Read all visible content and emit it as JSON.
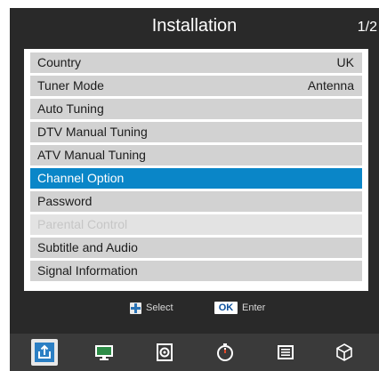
{
  "header": {
    "title": "Installation",
    "page_indicator": "1/2"
  },
  "menu": {
    "items": [
      {
        "label": "Country",
        "value": "UK",
        "state": "normal"
      },
      {
        "label": "Tuner Mode",
        "value": "Antenna",
        "state": "normal"
      },
      {
        "label": "Auto Tuning",
        "value": "",
        "state": "normal"
      },
      {
        "label": "DTV Manual Tuning",
        "value": "",
        "state": "normal"
      },
      {
        "label": "ATV Manual Tuning",
        "value": "",
        "state": "normal"
      },
      {
        "label": "Channel Option",
        "value": "",
        "state": "selected"
      },
      {
        "label": "Password",
        "value": "",
        "state": "normal"
      },
      {
        "label": "Parental Control",
        "value": "",
        "state": "disabled"
      },
      {
        "label": "Subtitle and Audio",
        "value": "",
        "state": "normal"
      },
      {
        "label": "Signal Information",
        "value": "",
        "state": "normal"
      }
    ]
  },
  "hints": {
    "select_label": "Select",
    "ok_key": "OK",
    "enter_label": "Enter"
  },
  "nav_bar": {
    "icons": [
      {
        "name": "installation-icon",
        "active": true
      },
      {
        "name": "picture-icon",
        "active": false
      },
      {
        "name": "sound-icon",
        "active": false
      },
      {
        "name": "timer-icon",
        "active": false
      },
      {
        "name": "options-icon",
        "active": false
      },
      {
        "name": "lock-cube-icon",
        "active": false
      }
    ]
  },
  "colors": {
    "background": "#292929",
    "selected": "#0a86c8",
    "item": "#d2d2d2",
    "disabled_text": "#c6c6c6"
  }
}
